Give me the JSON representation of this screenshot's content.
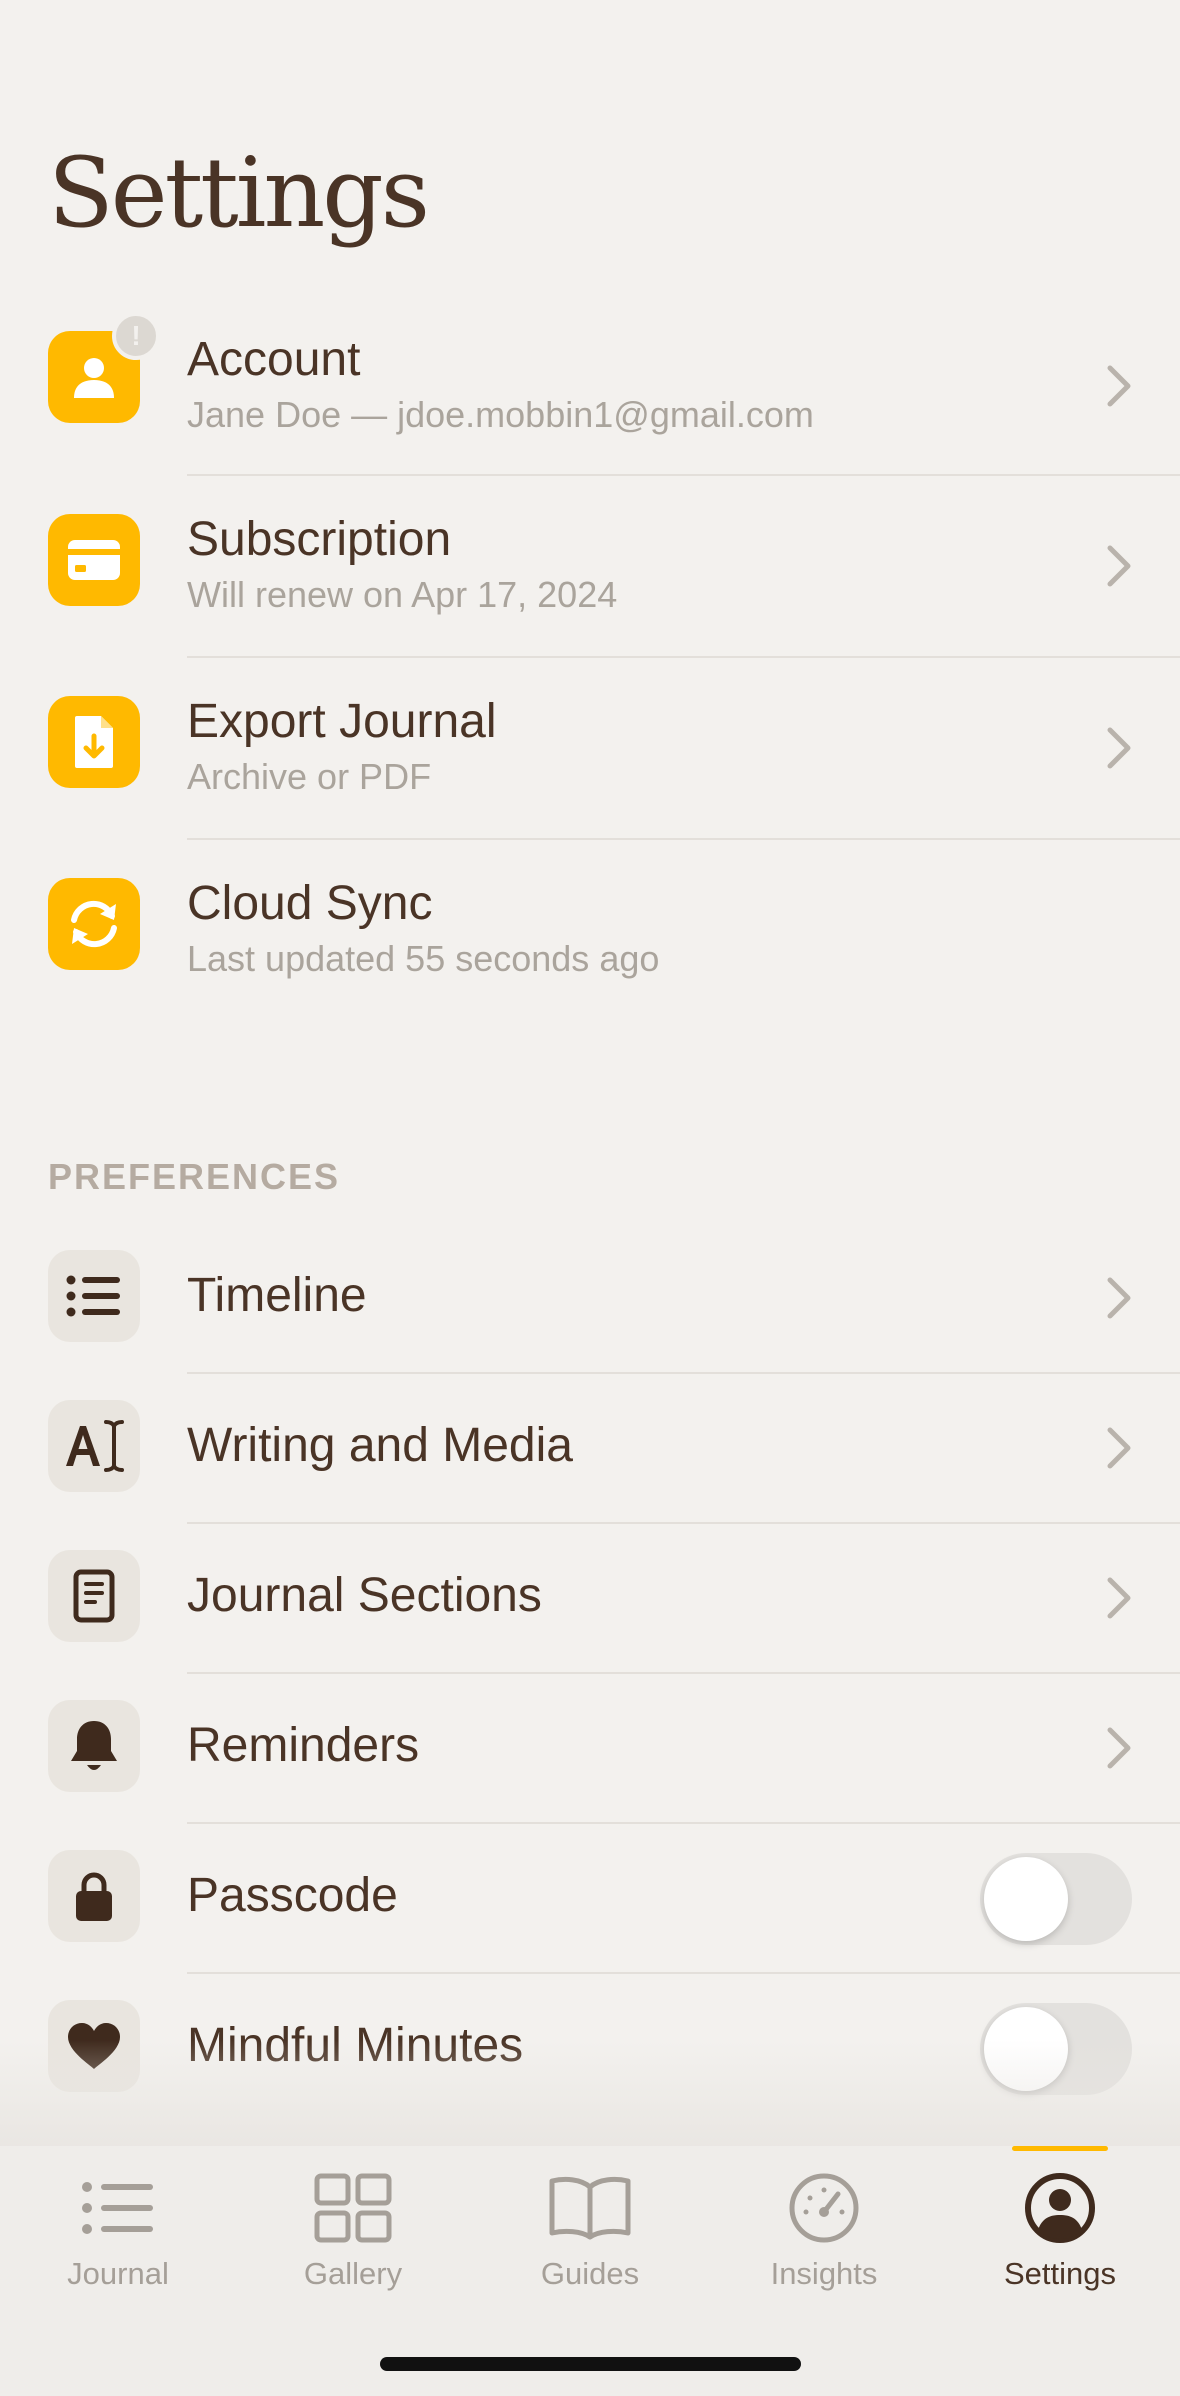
{
  "page": {
    "title": "Settings"
  },
  "account_rows": [
    {
      "title": "Account",
      "subtitle": "Jane Doe — jdoe.mobbin1@gmail.com",
      "icon": "person-icon",
      "badge": "!"
    },
    {
      "title": "Subscription",
      "subtitle": "Will renew on Apr 17, 2024",
      "icon": "credit-card-icon"
    },
    {
      "title": "Export Journal",
      "subtitle": "Archive or PDF",
      "icon": "document-download-icon"
    },
    {
      "title": "Cloud Sync",
      "subtitle": "Last updated 55 seconds ago",
      "icon": "sync-icon"
    }
  ],
  "preferences": {
    "header": "PREFERENCES",
    "items": [
      {
        "title": "Timeline",
        "icon": "list-icon",
        "control": "chevron"
      },
      {
        "title": "Writing and Media",
        "icon": "text-cursor-icon",
        "control": "chevron"
      },
      {
        "title": "Journal Sections",
        "icon": "page-icon",
        "control": "chevron"
      },
      {
        "title": "Reminders",
        "icon": "bell-icon",
        "control": "chevron"
      },
      {
        "title": "Passcode",
        "icon": "lock-icon",
        "control": "toggle",
        "on": false
      },
      {
        "title": "Mindful Minutes",
        "icon": "heart-icon",
        "control": "toggle",
        "on": false
      }
    ]
  },
  "tabbar": {
    "items": [
      {
        "label": "Journal",
        "icon": "list-icon",
        "active": false
      },
      {
        "label": "Gallery",
        "icon": "grid-icon",
        "active": false
      },
      {
        "label": "Guides",
        "icon": "book-icon",
        "active": false
      },
      {
        "label": "Insights",
        "icon": "gauge-icon",
        "active": false
      },
      {
        "label": "Settings",
        "icon": "profile-icon",
        "active": true
      }
    ]
  },
  "colors": {
    "accent": "#ffb900",
    "text": "#4a3426",
    "muted": "#aaa49c",
    "background": "#f3f1ee"
  }
}
